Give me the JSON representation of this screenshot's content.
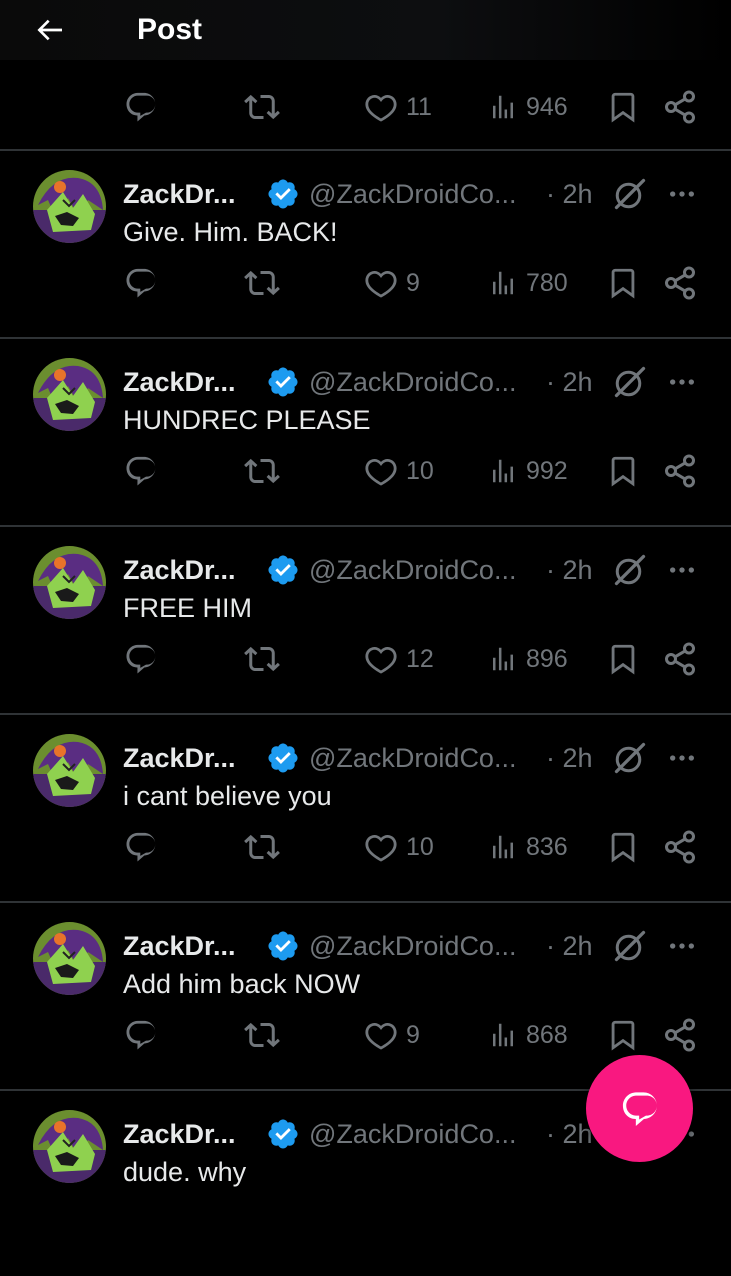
{
  "header": {
    "title": "Post"
  },
  "top_actions": {
    "likes": "11",
    "views": "946"
  },
  "posts": [
    {
      "name": "ZackDr...",
      "handle": "@ZackDroidCo...",
      "time": "· 2h",
      "text": "Give. Him. BACK!",
      "likes": "9",
      "views": "780"
    },
    {
      "name": "ZackDr...",
      "handle": "@ZackDroidCo...",
      "time": "· 2h",
      "text": "HUNDREC PLEASE",
      "likes": "10",
      "views": "992"
    },
    {
      "name": "ZackDr...",
      "handle": "@ZackDroidCo...",
      "time": "· 2h",
      "text": "FREE HIM",
      "likes": "12",
      "views": "896"
    },
    {
      "name": "ZackDr...",
      "handle": "@ZackDroidCo...",
      "time": "· 2h",
      "text": "i cant believe you",
      "likes": "10",
      "views": "836"
    },
    {
      "name": "ZackDr...",
      "handle": "@ZackDroidCo...",
      "time": "· 2h",
      "text": "Add him back NOW",
      "likes": "9",
      "views": "868"
    },
    {
      "name": "ZackDr...",
      "handle": "@ZackDroidCo...",
      "time": "· 2h",
      "text": "dude. why"
    }
  ],
  "colors": {
    "background": "#000000",
    "text": "#e7e9ea",
    "muted": "#71767b",
    "divider": "#2f3336",
    "verified": "#1d9bf0",
    "fab": "#f91880"
  },
  "icons": {
    "back": "arrow-left-icon",
    "reply": "reply-icon",
    "repost": "repost-icon",
    "like": "heart-icon",
    "views": "views-icon",
    "bookmark": "bookmark-icon",
    "share": "share-icon",
    "grok": "grok-icon",
    "more": "more-icon",
    "verified": "verified-badge-icon",
    "compose": "compose-reply-icon"
  }
}
